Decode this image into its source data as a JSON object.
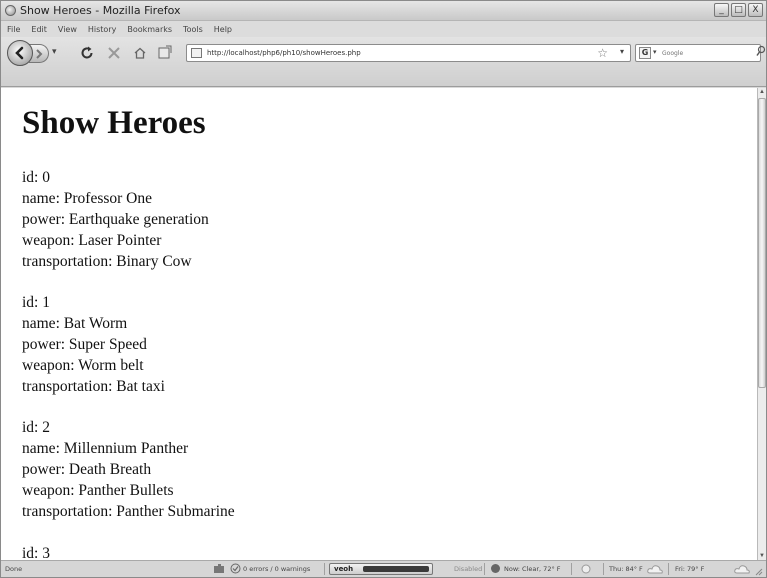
{
  "window": {
    "title": "Show Heroes - Mozilla Firefox",
    "controls": [
      "_",
      "□",
      "X"
    ]
  },
  "menu": [
    "File",
    "Edit",
    "View",
    "History",
    "Bookmarks",
    "Tools",
    "Help"
  ],
  "nav": {
    "url": "http://localhost/php6/ph10/showHeroes.php",
    "search_placeholder": "Google",
    "search_engine_glyph": "G"
  },
  "page": {
    "heading": "Show Heroes",
    "heroes": [
      {
        "id": "id: 0",
        "name": "name: Professor One",
        "power": "power: Earthquake generation",
        "weapon": "weapon: Laser Pointer",
        "transportation": "transportation: Binary Cow"
      },
      {
        "id": "id: 1",
        "name": "name: Bat Worm",
        "power": "power: Super Speed",
        "weapon": "weapon: Worm belt",
        "transportation": "transportation: Bat taxi"
      },
      {
        "id": "id: 2",
        "name": "name: Millennium Panther",
        "power": "power: Death Breath",
        "weapon": "weapon: Panther Bullets",
        "transportation": "transportation: Panther Submarine"
      },
      {
        "id": "id: 3"
      }
    ]
  },
  "status": {
    "left": "Done",
    "errors": "0 errors / 0 warnings",
    "addon_brand": "veoh",
    "disabled": "Disabled",
    "weather_now": "Now: Clear, 72° F",
    "weather_thu": "Thu: 84° F",
    "weather_fri": "Fri: 79° F"
  },
  "icons": {
    "back": "back-arrow-icon",
    "forward": "forward-arrow-icon",
    "reload": "reload-icon",
    "stop": "stop-icon",
    "home": "home-icon",
    "bookmark_page": "bookmark-page-icon",
    "star": "star-icon",
    "search": "magnifier-icon"
  }
}
